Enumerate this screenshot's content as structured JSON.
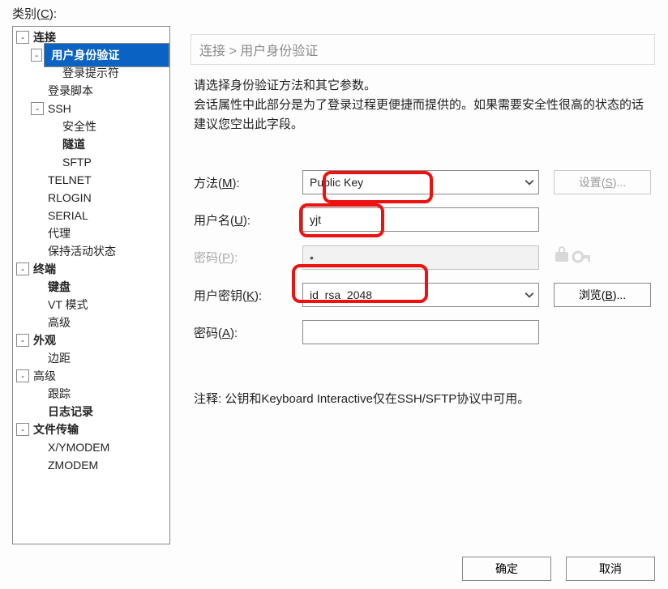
{
  "categoryLabel": {
    "pre": "类别(",
    "u": "C",
    "post": "):"
  },
  "tree": {
    "connection": "连接",
    "userAuth": "用户身份验证",
    "loginPrompt": "登录提示符",
    "loginScript": "登录脚本",
    "ssh": "SSH",
    "security": "安全性",
    "tunnel": "隧道",
    "sftp": "SFTP",
    "telnet": "TELNET",
    "rlogin": "RLOGIN",
    "serial": "SERIAL",
    "proxy": "代理",
    "keepAlive": "保持活动状态",
    "terminal": "终端",
    "keyboard": "键盘",
    "vtMode": "VT 模式",
    "advancedTerm": "高级",
    "appearance": "外观",
    "margin": "边距",
    "advanced": "高级",
    "trace": "跟踪",
    "logging": "日志记录",
    "fileTransfer": "文件传输",
    "xymodem": "X/YMODEM",
    "zmodem": "ZMODEM"
  },
  "breadcrumb": {
    "a": "连接",
    "sep": ">",
    "b": "用户身份验证"
  },
  "description": {
    "l1": "请选择身份验证方法和其它参数。",
    "l2": "会话属性中此部分是为了登录过程更便捷而提供的。如果需要安全性很高的状态的话建议您空出此字段。"
  },
  "form": {
    "method": {
      "labelPre": "方法(",
      "u": "M",
      "labelPost": "):",
      "value": "Public Key"
    },
    "user": {
      "labelPre": "用户名(",
      "u": "U",
      "labelPost": "):",
      "value": "yjt"
    },
    "pass": {
      "labelPre": "密码(",
      "u": "P",
      "labelPost": "):",
      "value": "•"
    },
    "userKey": {
      "labelPre": "用户密钥(",
      "u": "K",
      "labelPost": "):",
      "value": "id_rsa_2048"
    },
    "pass2": {
      "labelPre": "密码(",
      "u": "A",
      "labelPost": "):",
      "value": ""
    }
  },
  "buttons": {
    "settings": {
      "pre": "设置(",
      "u": "S",
      "post": ")..."
    },
    "browse": {
      "pre": "浏览(",
      "u": "B",
      "post": ")..."
    },
    "ok": "确定",
    "cancel": "取消"
  },
  "note": "注释: 公钥和Keyboard Interactive仅在SSH/SFTP协议中可用。"
}
